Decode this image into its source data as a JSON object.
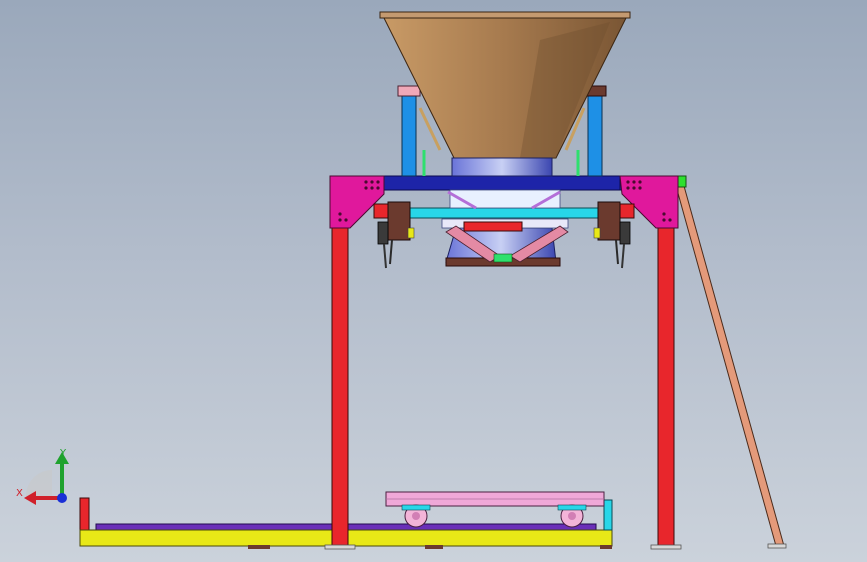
{
  "viewport": {
    "background_top": "#9aa8bb",
    "background_bottom": "#cbd2db"
  },
  "triad": {
    "x_label": "X",
    "y_label": "Y",
    "x_color": "#d0202a",
    "y_color": "#1fa22e",
    "z_color": "#1a2fd6"
  },
  "model": {
    "colors": {
      "hopper": "#a67a4e",
      "frame_legs": "#e8262c",
      "gusset_plates": "#e0189c",
      "top_beam": "#2530c8",
      "cyan_bar": "#28d6e8",
      "light_blue_posts": "#1e90e6",
      "ladder": "#e49a7a",
      "base_platform": "#e8e817",
      "base_rail": "#6a2fb8",
      "pallet_cart": "#f0a8d8",
      "mechanism_links": "#e48aa4",
      "dark_brackets": "#6b3a2e"
    }
  }
}
